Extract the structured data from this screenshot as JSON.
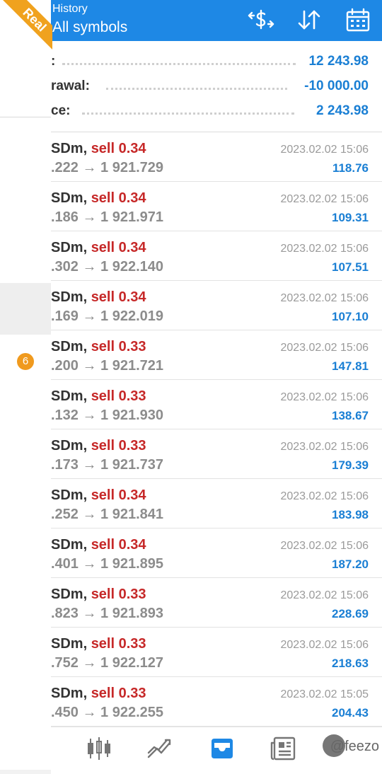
{
  "badge": {
    "account_type": "Real"
  },
  "header": {
    "title": "History",
    "subtitle": "All symbols"
  },
  "summary": [
    {
      "label": ":",
      "value": "12 243.98"
    },
    {
      "label": "rawal:",
      "value": "-10 000.00"
    },
    {
      "label": "ce:",
      "value": "2 243.98"
    }
  ],
  "drawer": {
    "notification_count": "6"
  },
  "trades": [
    {
      "symbol": "SDm,",
      "side": "sell",
      "volume": "0.34",
      "prices": ".222 → 1 921.729",
      "time": "2023.02.02 15:06",
      "profit": "118.76"
    },
    {
      "symbol": "SDm,",
      "side": "sell",
      "volume": "0.34",
      "prices": ".186 → 1 921.971",
      "time": "2023.02.02 15:06",
      "profit": "109.31"
    },
    {
      "symbol": "SDm,",
      "side": "sell",
      "volume": "0.34",
      "prices": ".302 → 1 922.140",
      "time": "2023.02.02 15:06",
      "profit": "107.51"
    },
    {
      "symbol": "SDm,",
      "side": "sell",
      "volume": "0.34",
      "prices": ".169 → 1 922.019",
      "time": "2023.02.02 15:06",
      "profit": "107.10"
    },
    {
      "symbol": "SDm,",
      "side": "sell",
      "volume": "0.33",
      "prices": ".200 → 1 921.721",
      "time": "2023.02.02 15:06",
      "profit": "147.81"
    },
    {
      "symbol": "SDm,",
      "side": "sell",
      "volume": "0.33",
      "prices": ".132 → 1 921.930",
      "time": "2023.02.02 15:06",
      "profit": "138.67"
    },
    {
      "symbol": "SDm,",
      "side": "sell",
      "volume": "0.33",
      "prices": ".173 → 1 921.737",
      "time": "2023.02.02 15:06",
      "profit": "179.39"
    },
    {
      "symbol": "SDm,",
      "side": "sell",
      "volume": "0.34",
      "prices": ".252 → 1 921.841",
      "time": "2023.02.02 15:06",
      "profit": "183.98"
    },
    {
      "symbol": "SDm,",
      "side": "sell",
      "volume": "0.34",
      "prices": ".401 → 1 921.895",
      "time": "2023.02.02 15:06",
      "profit": "187.20"
    },
    {
      "symbol": "SDm,",
      "side": "sell",
      "volume": "0.33",
      "prices": ".823 → 1 921.893",
      "time": "2023.02.02 15:06",
      "profit": "228.69"
    },
    {
      "symbol": "SDm,",
      "side": "sell",
      "volume": "0.33",
      "prices": ".752 → 1 922.127",
      "time": "2023.02.02 15:06",
      "profit": "218.63"
    },
    {
      "symbol": "SDm,",
      "side": "sell",
      "volume": "0.33",
      "prices": ".450 → 1 922.255",
      "time": "2023.02.02 15:05",
      "profit": "204.43"
    }
  ],
  "nav": {
    "items": [
      {
        "icon": "quotes-icon"
      },
      {
        "icon": "chart-icon"
      },
      {
        "icon": "history-icon",
        "active": true
      },
      {
        "icon": "news-icon"
      }
    ],
    "watermark": "@feezo"
  },
  "colors": {
    "header": "#1e88e5",
    "profit": "#1a7fd4",
    "sell": "#c62828",
    "badge": "#f0a21e"
  }
}
